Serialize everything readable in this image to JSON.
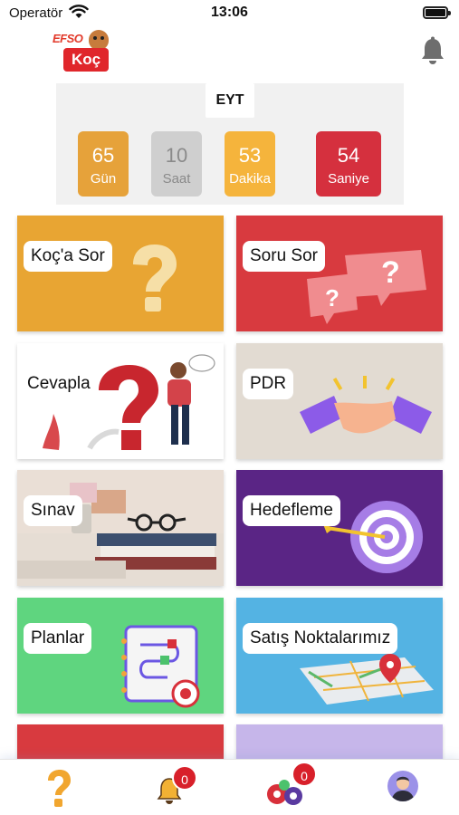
{
  "status_bar": {
    "carrier": "Operatör",
    "time": "13:06"
  },
  "header": {
    "logo_text_top": "EFSO",
    "logo_text_bottom": "Koç"
  },
  "countdown": {
    "title": "EYT",
    "days": {
      "value": "65",
      "label": "Gün"
    },
    "hours": {
      "value": "10",
      "label": "Saat"
    },
    "minutes": {
      "value": "53",
      "label": "Dakika"
    },
    "seconds": {
      "value": "54",
      "label": "Saniye"
    }
  },
  "tiles": [
    {
      "label": "Koç'a Sor",
      "color": "#e8a533",
      "icon": "question-mark-icon"
    },
    {
      "label": "Soru Sor",
      "color": "#d83a3f",
      "icon": "speech-bubbles-icon"
    },
    {
      "label": "Cevapla",
      "color": "#ffffff",
      "icon": "thinking-person-icon"
    },
    {
      "label": "PDR",
      "color": "#e2dbd2",
      "icon": "handshake-icon"
    },
    {
      "label": "Sınav",
      "color": "#efe7e2",
      "icon": "books-glasses-icon"
    },
    {
      "label": "Hedefleme",
      "color": "#5a2585",
      "icon": "target-arrow-icon"
    },
    {
      "label": "Planlar",
      "color": "#5fd57f",
      "icon": "planner-notebook-icon"
    },
    {
      "label": "Satış Noktalarımız",
      "color": "#54b3e3",
      "icon": "map-pin-icon"
    }
  ],
  "tab_bar": {
    "items": [
      {
        "icon": "question-tab-icon"
      },
      {
        "icon": "notification-bell-icon",
        "badge": "0"
      },
      {
        "icon": "messages-icon",
        "badge": "0"
      },
      {
        "icon": "profile-avatar-icon"
      }
    ]
  },
  "colors": {
    "accent_red": "#d8202a",
    "accent_orange": "#e8a533",
    "purple": "#5a2585"
  }
}
